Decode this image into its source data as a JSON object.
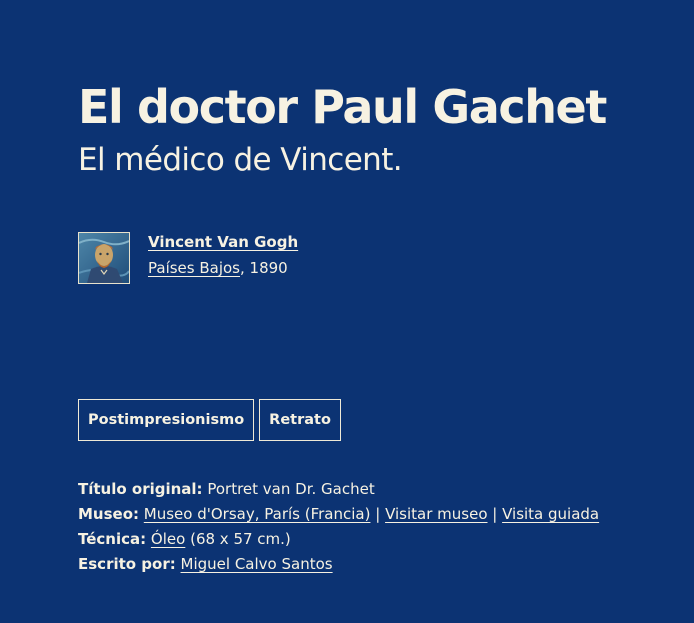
{
  "artwork": {
    "title": "El doctor Paul Gachet",
    "subtitle": "El médico de Vincent."
  },
  "artist": {
    "name": "Vincent Van Gogh",
    "country": "Países Bajos",
    "year_sep": ", ",
    "year": "1890",
    "avatar_icon": "artist-portrait-thumbnail"
  },
  "tags": [
    {
      "label": "Postimpresionismo"
    },
    {
      "label": "Retrato"
    }
  ],
  "details": {
    "original_title_label": "Título original:",
    "original_title": "Portret van Dr. Gachet",
    "museum_label": "Museo:",
    "museum_name": "Museo d'Orsay, París (Francia)",
    "sep1": " | ",
    "visit_museum": "Visitar museo",
    "sep2": " | ",
    "guided_tour": "Visita guiada",
    "technique_label": "Técnica:",
    "technique": "Óleo",
    "dimensions": "(68 x 57 cm.)",
    "author_label": "Escrito por:",
    "author": "Miguel Calvo Santos"
  },
  "colors": {
    "background": "#0c3373",
    "text": "#f7f2e2"
  }
}
